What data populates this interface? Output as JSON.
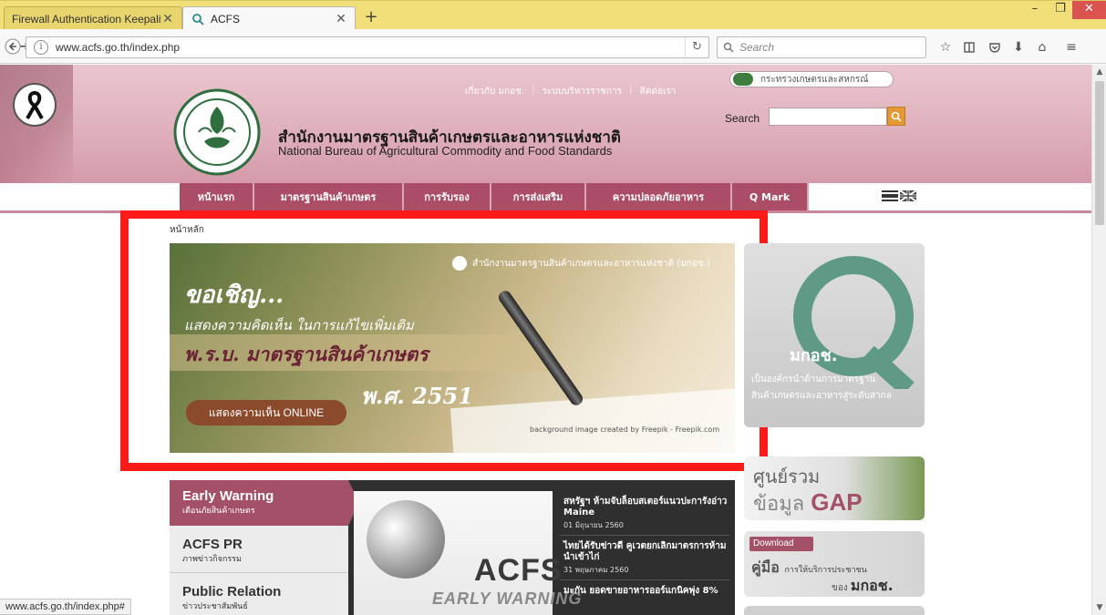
{
  "browser": {
    "tabs": [
      {
        "title": "Firewall Authentication Keepaliv",
        "active": false
      },
      {
        "title": "ACFS",
        "active": true
      }
    ],
    "new_tab_glyph": "+",
    "url": "www.acfs.go.th/index.php",
    "search_placeholder": "Search",
    "status_url": "www.acfs.go.th/index.php#",
    "window_controls": {
      "min": "–",
      "max": "❐",
      "close": "✕"
    }
  },
  "header": {
    "org_thai": "สำนักงานมาตรฐานสินค้าเกษตรและอาหารแห่งชาติ",
    "org_en": "National Bureau of Agricultural Commodity and Food Standards",
    "top_links": [
      "เกี่ยวกับ มกอช.",
      "ระบบบริหารราชการ",
      "ติดต่อเรา"
    ],
    "ministry": "กระทรวงเกษตรและสหกรณ์",
    "search_label": "Search"
  },
  "nav": {
    "items": [
      "หน้าแรก",
      "มาตรฐานสินค้าเกษตร",
      "การรับรอง",
      "การส่งเสริม",
      "ความปลอดภัยอาหาร",
      "Q Mark"
    ]
  },
  "breadcrumb": "หน้าหลัก",
  "banner": {
    "org_line": "สำนักงานมาตรฐานสินค้าเกษตรและอาหารแห่งชาติ (มกอช.)",
    "headline1": "ขอเชิญ...",
    "headline2": "แสดงความคิดเห็น ในการแก้ไขเพิ่มเติม",
    "headline3": "พ.ร.บ. มาตรฐานสินค้าเกษตร",
    "headline4": "พ.ศ. 2551",
    "cta": "แสดงความเห็น ONLINE",
    "credit": "background image created by Freepik - Freepik.com"
  },
  "qbox": {
    "title": "มกอช.",
    "desc_line1": "เป็นองค์กรนำด้านการมาตรฐาน",
    "desc_line2": "สินค้าเกษตรและอาหารสู่ระดับสากล"
  },
  "side_tabs": [
    {
      "title": "Early Warning",
      "subtitle": "เตือนภัยสินค้าเกษตร"
    },
    {
      "title": "ACFS PR",
      "subtitle": "ภาพข่าวกิจกรรม"
    },
    {
      "title": "Public Relation",
      "subtitle": "ข่าวประชาสัมพันธ์"
    }
  ],
  "ew_image": {
    "logo": "ACFS",
    "sub": "EARLY WARNING"
  },
  "news": [
    {
      "title": "สหรัฐฯ ห้ามจับล็อบสเตอร์แนวปะการังอ่าว Maine",
      "date": "01 มิถุนายน 2560"
    },
    {
      "title": "ไทยได้รับข่าวดี คูเวตยกเลิกมาตรการห้ามนำเข้าไก่",
      "date": "31 พฤษภาคม 2560"
    },
    {
      "title": "มะกัน ยอดขายอาหารออร์แกนิคพุ่ง 8%",
      "date": ""
    }
  ],
  "gap_box": {
    "line1": "ศูนย์รวม",
    "line2a": "ข้อมูล",
    "line2b": "GAP"
  },
  "download_box": {
    "badge": "Download",
    "manual": "คู่มือ",
    "manual_sub": "การให้บริการประชาชน",
    "of": "ของ",
    "org": "มกอช."
  },
  "colors": {
    "nav": "#ab4d67",
    "header": "#dfb1bd",
    "highlight": "#ff1a1a",
    "tabstrip": "#f1e07a"
  }
}
